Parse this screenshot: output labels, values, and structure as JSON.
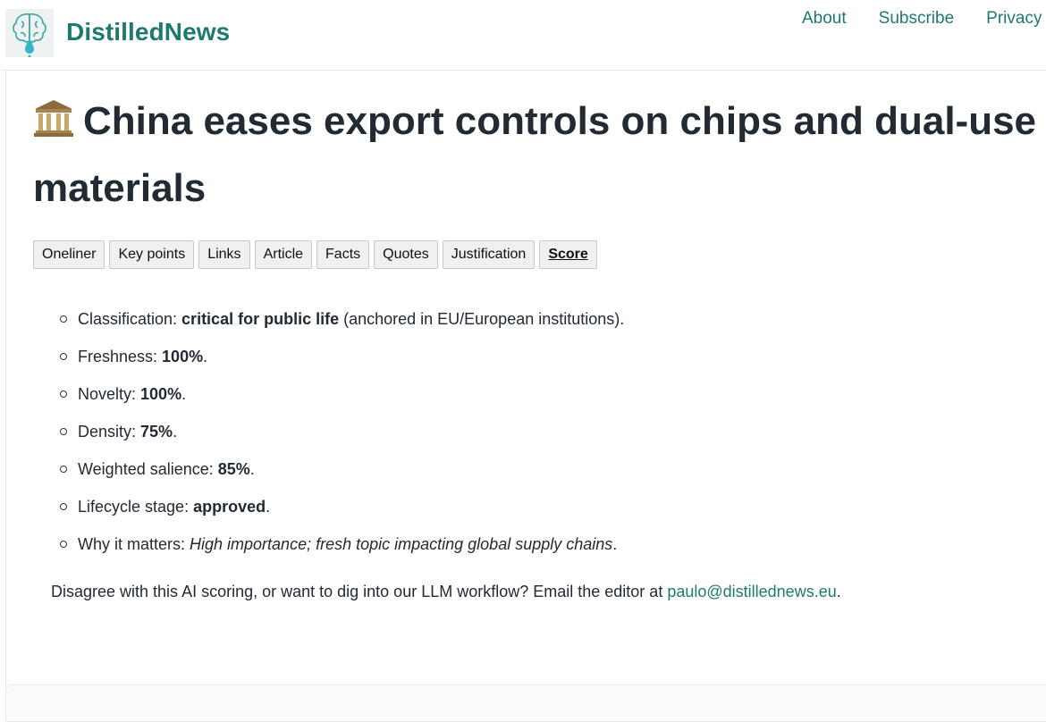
{
  "header": {
    "logo_icon": "brain-drop-icon",
    "site_name": "DistilledNews",
    "nav": [
      "About",
      "Subscribe",
      "Privacy"
    ]
  },
  "article": {
    "title_icon": "classical-building-icon",
    "title": "China eases export controls on chips and dual-use materials",
    "tabs": [
      "Oneliner",
      "Key points",
      "Links",
      "Article",
      "Facts",
      "Quotes",
      "Justification",
      "Score"
    ],
    "active_tab": "Score",
    "score": {
      "classification": {
        "label": "Classification: ",
        "value": "critical for public life",
        "suffix": " (anchored in EU/European institutions)."
      },
      "freshness": {
        "label": "Freshness: ",
        "value": "100%",
        "suffix": "."
      },
      "novelty": {
        "label": "Novelty: ",
        "value": "100%",
        "suffix": "."
      },
      "density": {
        "label": "Density: ",
        "value": "75%",
        "suffix": "."
      },
      "weighted_salience": {
        "label": "Weighted salience: ",
        "value": "85%",
        "suffix": "."
      },
      "lifecycle": {
        "label": "Lifecycle stage: ",
        "value": "approved",
        "suffix": "."
      },
      "why": {
        "label": "Why it matters: ",
        "value": "High importance; fresh topic impacting global supply chains",
        "suffix": "."
      }
    },
    "note": {
      "text": "Disagree with this AI scoring, or want to dig into our LLM workflow? Email the editor at ",
      "email": "paulo@distillednews.eu",
      "suffix": "."
    }
  },
  "colors": {
    "brand": "#1f7a6e",
    "text": "#222a33"
  }
}
